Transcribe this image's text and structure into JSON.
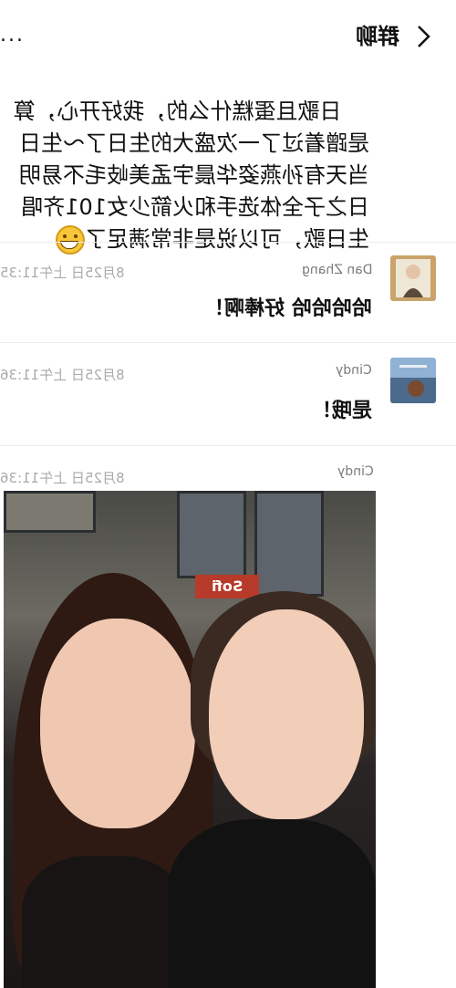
{
  "header": {
    "title": "群聊",
    "more_label": "..."
  },
  "top_message": {
    "text": "日歌且蛋糕什么的，我好开心，算是蹭着过了一次盛大的生日了～生日当天有孙燕姿华晨宇孟美岐毛不易明日之子全体选手和火箭少女101齐唱生日歌，可以说是非常满足了"
  },
  "messages": [
    {
      "name": "Dan Zhang",
      "time": "8月25日 上午11:35",
      "text": "哈哈哈哈 好棒啊！"
    },
    {
      "name": "Cindy",
      "time": "8月25日 上午11:36",
      "text": "是哦！"
    },
    {
      "name": "Cindy",
      "time": "8月25日 上午11:36",
      "text": ""
    }
  ],
  "photo": {
    "sign_text": "Sofi"
  },
  "icons": {
    "back": "chevron-left-icon",
    "more": "more-dots-icon",
    "emoji": "grin-emoji-icon"
  }
}
